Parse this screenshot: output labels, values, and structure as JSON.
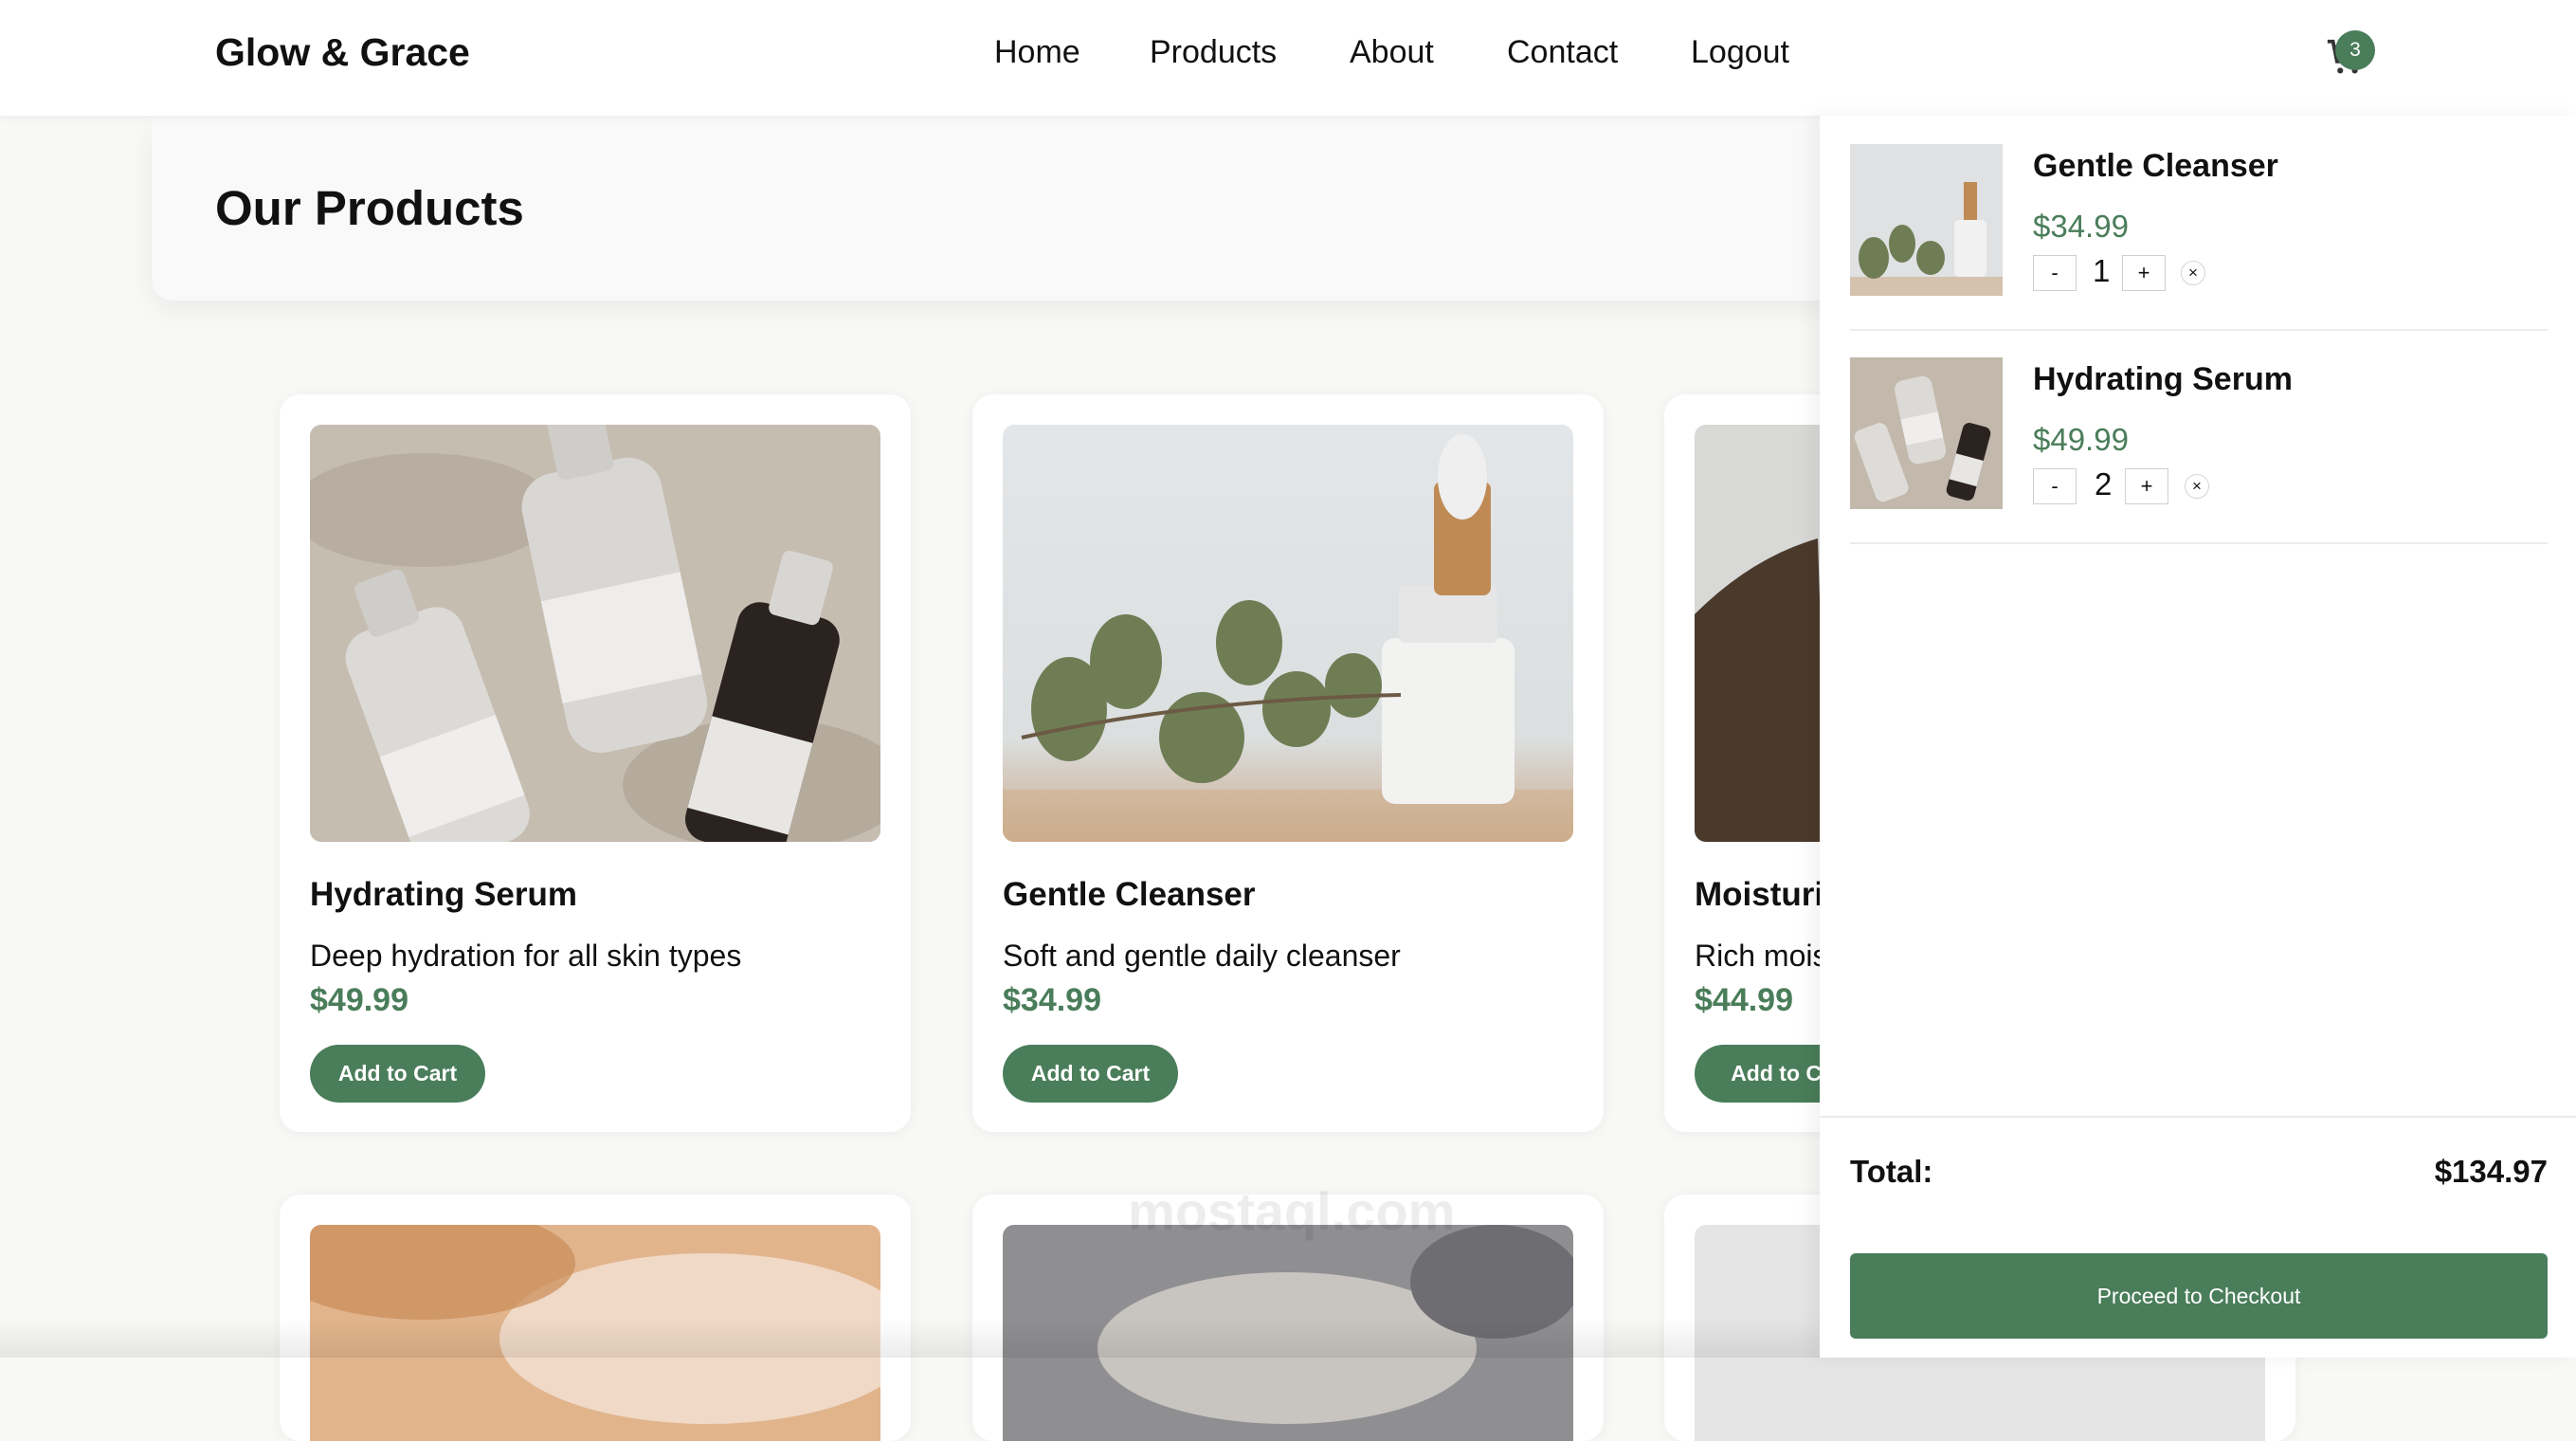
{
  "header": {
    "brand": "Glow & Grace",
    "nav": [
      "Home",
      "Products",
      "About",
      "Contact",
      "Logout"
    ],
    "cart_count": "3"
  },
  "hero": {
    "title": "Our Products"
  },
  "products": [
    {
      "name": "Hydrating Serum",
      "desc": "Deep hydration for all skin types",
      "price": "$49.99",
      "button": "Add to Cart"
    },
    {
      "name": "Gentle Cleanser",
      "desc": "Soft and gentle daily cleanser",
      "price": "$34.99",
      "button": "Add to Cart"
    },
    {
      "name": "Moisturi",
      "desc": "Rich mois",
      "price": "$44.99",
      "button": "Add to Ca"
    }
  ],
  "watermark": "mostaql.com",
  "cart": {
    "items": [
      {
        "name": "Gentle Cleanser",
        "price": "$34.99",
        "qty": "1",
        "minus": "-",
        "plus": "+",
        "remove": "×"
      },
      {
        "name": "Hydrating Serum",
        "price": "$49.99",
        "qty": "2",
        "minus": "-",
        "plus": "+",
        "remove": "×"
      }
    ],
    "total_label": "Total:",
    "total_value": "$134.97",
    "checkout_label": "Proceed to Checkout"
  },
  "colors": {
    "accent": "#4a7d5a",
    "background": "#f8f8f6"
  }
}
